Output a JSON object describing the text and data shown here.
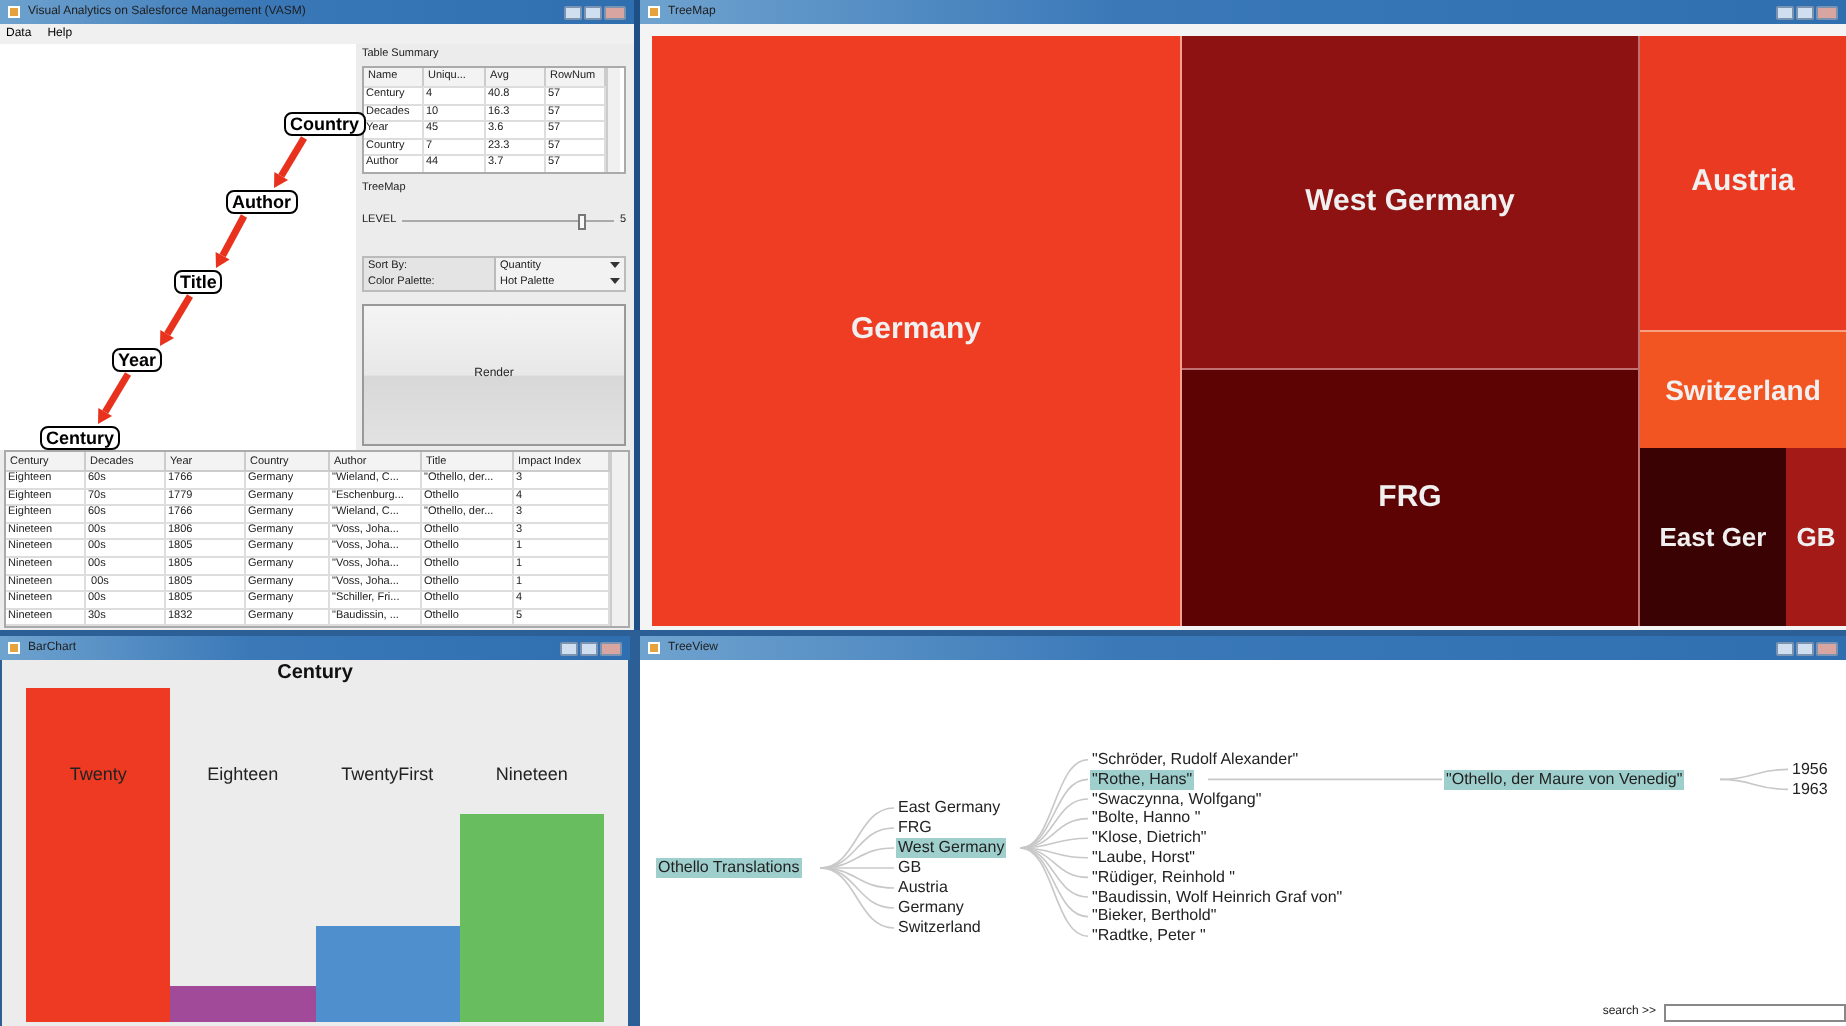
{
  "main_window": {
    "title": "Visual Analytics on Salesforce Management (VASM)",
    "menu": [
      "Data",
      "Help"
    ],
    "graph": {
      "nodes": [
        {
          "label": "Country"
        },
        {
          "label": "Author"
        },
        {
          "label": "Title"
        },
        {
          "label": "Year"
        },
        {
          "label": "Century"
        }
      ]
    },
    "summary": {
      "title": "Table Summary",
      "columns": [
        "Name",
        "Uniqu...",
        "Avg",
        "RowNum"
      ],
      "rows": [
        [
          "Century",
          "4",
          "40.8",
          "57"
        ],
        [
          "Decades",
          "10",
          "16.3",
          "57"
        ],
        [
          "Year",
          "45",
          "3.6",
          "57"
        ],
        [
          "Country",
          "7",
          "23.3",
          "57"
        ],
        [
          "Author",
          "44",
          "3.7",
          "57"
        ]
      ]
    },
    "treemap_settings": {
      "title": "TreeMap",
      "slider": {
        "label": "LEVEL",
        "level": 0.85,
        "reading": "5"
      },
      "options": [
        {
          "label": "Sort By:",
          "value": "Quantity"
        },
        {
          "label": "Color Palette:",
          "value": "Hot Palette"
        }
      ],
      "button": "Render"
    },
    "table": {
      "columns": [
        "Century",
        "Decades",
        "Year",
        "Country",
        "Author",
        "Title",
        "Impact Index"
      ],
      "rows": [
        [
          "Eighteen",
          "60s",
          "1766",
          "Germany",
          "\"Wieland, C...",
          "\"Othello, der...",
          "3"
        ],
        [
          "Eighteen",
          "70s",
          "1779",
          "Germany",
          "\"Eschenburg...",
          "Othello",
          "4"
        ],
        [
          "Eighteen",
          "60s",
          "1766",
          "Germany",
          "\"Wieland, C...",
          "\"Othello, der...",
          "3"
        ],
        [
          "Nineteen",
          "00s",
          "1806",
          "Germany",
          "\"Voss, Joha...",
          "Othello",
          "3"
        ],
        [
          "Nineteen",
          "00s",
          "1805",
          "Germany",
          "\"Voss, Joha...",
          "Othello",
          "1"
        ],
        [
          "Nineteen",
          "00s",
          "1805",
          "Germany",
          "\"Voss, Joha...",
          "Othello",
          "1"
        ],
        [
          "Nineteen",
          " 00s",
          "1805",
          "Germany",
          "\"Voss, Joha...",
          "Othello",
          "1"
        ],
        [
          "Nineteen",
          "00s",
          "1805",
          "Germany",
          "\"Schiller, Fri...",
          "Othello",
          "4"
        ],
        [
          "Nineteen",
          "30s",
          "1832",
          "Germany",
          "\"Baudissin, ...",
          "Othello",
          "5"
        ]
      ]
    }
  },
  "treemap_window": {
    "title": "TreeMap",
    "cells": [
      {
        "label": "Germany",
        "color": "#ee3d22"
      },
      {
        "label": "West Germany",
        "color": "#8e1212"
      },
      {
        "label": "FRG",
        "color": "#5e0303"
      },
      {
        "label": "Austria",
        "color": "#ea3a22"
      },
      {
        "label": "Switzerland",
        "color": "#f25422"
      },
      {
        "label": "East Ger",
        "color": "#3a0202"
      },
      {
        "label": "GB",
        "color": "#a31a16"
      }
    ]
  },
  "barchart_window": {
    "title": "BarChart",
    "chart_title": "Century",
    "bars": [
      {
        "label": "Twenty",
        "color": "#ee3a22"
      },
      {
        "label": "Eighteen",
        "color": "#a24a9a"
      },
      {
        "label": "TwentyFirst",
        "color": "#4f8fcd"
      },
      {
        "label": "Nineteen",
        "color": "#68bd5e"
      }
    ]
  },
  "treeview_window": {
    "title": "TreeView",
    "tree": {
      "label": "Othello Translations",
      "selected": true,
      "children": [
        {
          "label": "East Germany",
          "selected": false
        },
        {
          "label": "FRG",
          "selected": false
        },
        {
          "label": "West Germany",
          "selected": true,
          "children": [
            {
              "label": "\"Schröder, Rudolf Alexander\"",
              "selected": false
            },
            {
              "label": "\"Rothe, Hans\"",
              "selected": true,
              "children": [
                {
                  "label": "\"Othello, der Maure von Venedig\"",
                  "selected": true,
                  "children": [
                    {
                      "label": "1956",
                      "selected": false
                    },
                    {
                      "label": "1963",
                      "selected": false
                    }
                  ]
                }
              ]
            },
            {
              "label": "\"Swaczynna, Wolfgang\"",
              "selected": false
            },
            {
              "label": "\"Bolte, Hanno \"",
              "selected": false
            },
            {
              "label": "\"Klose, Dietrich\"",
              "selected": false
            },
            {
              "label": "\"Laube, Horst\"",
              "selected": false
            },
            {
              "label": "\"Rüdiger, Reinhold \"",
              "selected": false
            },
            {
              "label": "\"Baudissin, Wolf Heinrich Graf von\"",
              "selected": false
            },
            {
              "label": "\"Bieker, Berthold\"",
              "selected": false
            },
            {
              "label": "\"Radtke, Peter \"",
              "selected": false
            }
          ]
        },
        {
          "label": "GB",
          "selected": false
        },
        {
          "label": "Austria",
          "selected": false
        },
        {
          "label": "Germany",
          "selected": false
        },
        {
          "label": "Switzerland",
          "selected": false
        }
      ]
    },
    "search": {
      "label": "search >>"
    }
  }
}
